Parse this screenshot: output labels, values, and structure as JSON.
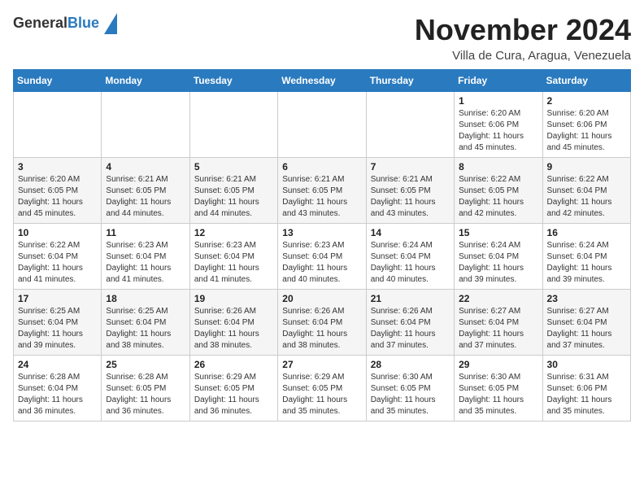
{
  "header": {
    "logo_general": "General",
    "logo_blue": "Blue",
    "month": "November 2024",
    "location": "Villa de Cura, Aragua, Venezuela"
  },
  "weekdays": [
    "Sunday",
    "Monday",
    "Tuesday",
    "Wednesday",
    "Thursday",
    "Friday",
    "Saturday"
  ],
  "weeks": [
    [
      {
        "day": "",
        "info": ""
      },
      {
        "day": "",
        "info": ""
      },
      {
        "day": "",
        "info": ""
      },
      {
        "day": "",
        "info": ""
      },
      {
        "day": "",
        "info": ""
      },
      {
        "day": "1",
        "info": "Sunrise: 6:20 AM\nSunset: 6:06 PM\nDaylight: 11 hours and 45 minutes."
      },
      {
        "day": "2",
        "info": "Sunrise: 6:20 AM\nSunset: 6:06 PM\nDaylight: 11 hours and 45 minutes."
      }
    ],
    [
      {
        "day": "3",
        "info": "Sunrise: 6:20 AM\nSunset: 6:05 PM\nDaylight: 11 hours and 45 minutes."
      },
      {
        "day": "4",
        "info": "Sunrise: 6:21 AM\nSunset: 6:05 PM\nDaylight: 11 hours and 44 minutes."
      },
      {
        "day": "5",
        "info": "Sunrise: 6:21 AM\nSunset: 6:05 PM\nDaylight: 11 hours and 44 minutes."
      },
      {
        "day": "6",
        "info": "Sunrise: 6:21 AM\nSunset: 6:05 PM\nDaylight: 11 hours and 43 minutes."
      },
      {
        "day": "7",
        "info": "Sunrise: 6:21 AM\nSunset: 6:05 PM\nDaylight: 11 hours and 43 minutes."
      },
      {
        "day": "8",
        "info": "Sunrise: 6:22 AM\nSunset: 6:05 PM\nDaylight: 11 hours and 42 minutes."
      },
      {
        "day": "9",
        "info": "Sunrise: 6:22 AM\nSunset: 6:04 PM\nDaylight: 11 hours and 42 minutes."
      }
    ],
    [
      {
        "day": "10",
        "info": "Sunrise: 6:22 AM\nSunset: 6:04 PM\nDaylight: 11 hours and 41 minutes."
      },
      {
        "day": "11",
        "info": "Sunrise: 6:23 AM\nSunset: 6:04 PM\nDaylight: 11 hours and 41 minutes."
      },
      {
        "day": "12",
        "info": "Sunrise: 6:23 AM\nSunset: 6:04 PM\nDaylight: 11 hours and 41 minutes."
      },
      {
        "day": "13",
        "info": "Sunrise: 6:23 AM\nSunset: 6:04 PM\nDaylight: 11 hours and 40 minutes."
      },
      {
        "day": "14",
        "info": "Sunrise: 6:24 AM\nSunset: 6:04 PM\nDaylight: 11 hours and 40 minutes."
      },
      {
        "day": "15",
        "info": "Sunrise: 6:24 AM\nSunset: 6:04 PM\nDaylight: 11 hours and 39 minutes."
      },
      {
        "day": "16",
        "info": "Sunrise: 6:24 AM\nSunset: 6:04 PM\nDaylight: 11 hours and 39 minutes."
      }
    ],
    [
      {
        "day": "17",
        "info": "Sunrise: 6:25 AM\nSunset: 6:04 PM\nDaylight: 11 hours and 39 minutes."
      },
      {
        "day": "18",
        "info": "Sunrise: 6:25 AM\nSunset: 6:04 PM\nDaylight: 11 hours and 38 minutes."
      },
      {
        "day": "19",
        "info": "Sunrise: 6:26 AM\nSunset: 6:04 PM\nDaylight: 11 hours and 38 minutes."
      },
      {
        "day": "20",
        "info": "Sunrise: 6:26 AM\nSunset: 6:04 PM\nDaylight: 11 hours and 38 minutes."
      },
      {
        "day": "21",
        "info": "Sunrise: 6:26 AM\nSunset: 6:04 PM\nDaylight: 11 hours and 37 minutes."
      },
      {
        "day": "22",
        "info": "Sunrise: 6:27 AM\nSunset: 6:04 PM\nDaylight: 11 hours and 37 minutes."
      },
      {
        "day": "23",
        "info": "Sunrise: 6:27 AM\nSunset: 6:04 PM\nDaylight: 11 hours and 37 minutes."
      }
    ],
    [
      {
        "day": "24",
        "info": "Sunrise: 6:28 AM\nSunset: 6:04 PM\nDaylight: 11 hours and 36 minutes."
      },
      {
        "day": "25",
        "info": "Sunrise: 6:28 AM\nSunset: 6:05 PM\nDaylight: 11 hours and 36 minutes."
      },
      {
        "day": "26",
        "info": "Sunrise: 6:29 AM\nSunset: 6:05 PM\nDaylight: 11 hours and 36 minutes."
      },
      {
        "day": "27",
        "info": "Sunrise: 6:29 AM\nSunset: 6:05 PM\nDaylight: 11 hours and 35 minutes."
      },
      {
        "day": "28",
        "info": "Sunrise: 6:30 AM\nSunset: 6:05 PM\nDaylight: 11 hours and 35 minutes."
      },
      {
        "day": "29",
        "info": "Sunrise: 6:30 AM\nSunset: 6:05 PM\nDaylight: 11 hours and 35 minutes."
      },
      {
        "day": "30",
        "info": "Sunrise: 6:31 AM\nSunset: 6:06 PM\nDaylight: 11 hours and 35 minutes."
      }
    ]
  ]
}
